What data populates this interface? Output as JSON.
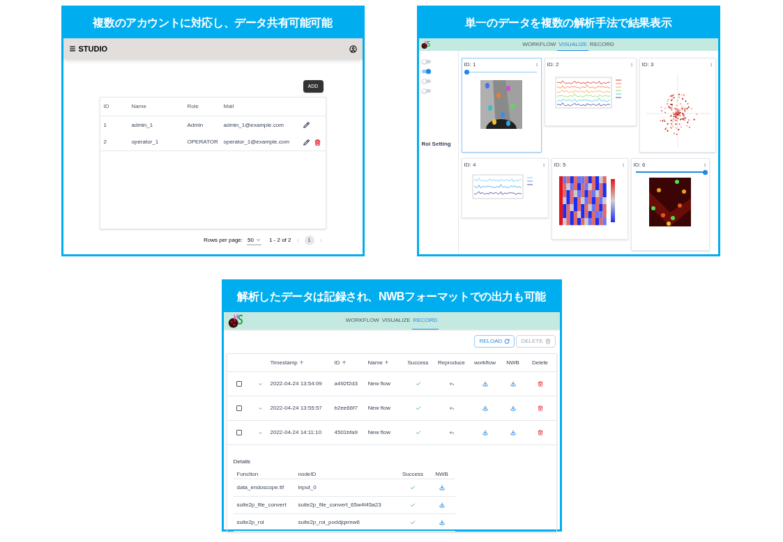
{
  "panels": [
    {
      "kind": "users",
      "caption": "複数のアカウントに対応し、データ共有可能可能",
      "app_title": "STUDIO",
      "add_button": "ADD",
      "columns": [
        "ID",
        "Name",
        "Role",
        "Mail"
      ],
      "rows": [
        {
          "id": "1",
          "name": "admin_1",
          "role": "Admin",
          "mail": "admin_1@example.com",
          "deletable": false
        },
        {
          "id": "2",
          "name": "operator_1",
          "role": "OPERATOR",
          "mail": "operator_1@example.com",
          "deletable": true
        }
      ],
      "pagination": {
        "label": "Rows per page:",
        "per_page": "50",
        "range": "1 - 2 of 2",
        "page": "1"
      }
    },
    {
      "kind": "visualize",
      "caption": "単一のデータを複数の解析手法で結果表示",
      "tabs": [
        {
          "label": "WORKFLOW",
          "selected": false
        },
        {
          "label": "VISUALIZE",
          "selected": true
        },
        {
          "label": "RECORD",
          "selected": false
        }
      ],
      "toggles": [
        {
          "on": false
        },
        {
          "on": true
        },
        {
          "on": false
        },
        {
          "on": false
        }
      ],
      "section_title": "Roi Setting",
      "cards": [
        {
          "label": "ID: 1",
          "selected": true,
          "level": 0
        },
        {
          "kind": "lines",
          "label": "ID: 2",
          "selected": false
        },
        {
          "kind": "scatter",
          "label": "ID: 3",
          "selected": false
        },
        {
          "kind": "traces",
          "label": "ID: 4",
          "selected": false
        },
        {
          "kind": "heatmap",
          "label": "ID: 5",
          "selected": false
        },
        {
          "kind": "roi",
          "label": "ID: 6",
          "selected": false,
          "level": 1
        }
      ]
    },
    {
      "kind": "record",
      "caption": "解析したデータは記録され、NWBフォーマットでの出力も可能",
      "tabs": [
        {
          "label": "WORKFLOW",
          "selected": false
        },
        {
          "label": "VISUALIZE",
          "selected": false
        },
        {
          "label": "RECORD",
          "selected": true
        }
      ],
      "buttons": [
        {
          "label": "RELOAD",
          "disabled": false
        },
        {
          "label": "DELETE",
          "disabled": true
        }
      ],
      "columns": [
        {
          "label": "Timestamp",
          "sortable": true
        },
        {
          "label": "ID",
          "sortable": true
        },
        {
          "label": "Name",
          "sortable": true
        },
        {
          "label": "Success",
          "sortable": false
        },
        {
          "label": "Reproduce",
          "sortable": false
        },
        {
          "label": "workflow",
          "sortable": false
        },
        {
          "label": "NWB",
          "sortable": false
        },
        {
          "label": "Delete",
          "sortable": false
        }
      ],
      "rows": [
        {
          "checked": false,
          "expanded": false,
          "timestamp": "2022-04-24 13:54:09",
          "id": "a492f2d3",
          "name": "New flow",
          "success": true
        },
        {
          "checked": false,
          "expanded": false,
          "timestamp": "2022-04-24 13:55:57",
          "id": "b2ee66f7",
          "name": "New flow",
          "success": true
        },
        {
          "checked": false,
          "expanded": true,
          "timestamp": "2022-04-24 14:11:10",
          "id": "4501bfa9",
          "name": "New flow",
          "success": true
        }
      ],
      "details": {
        "title": "Details",
        "columns": [
          "Function",
          "nodeID",
          "Success",
          "NWB"
        ],
        "rows": [
          {
            "function": "data_endoscope.tif",
            "node_id": "input_0",
            "success": true
          },
          {
            "function": "suite2p_file_convert",
            "node_id": "suite2p_file_convert_65w4t45a23",
            "success": true
          },
          {
            "function": "suite2p_roi",
            "node_id": "suite2p_roi_poddjqxmw6",
            "success": true
          }
        ]
      }
    }
  ]
}
